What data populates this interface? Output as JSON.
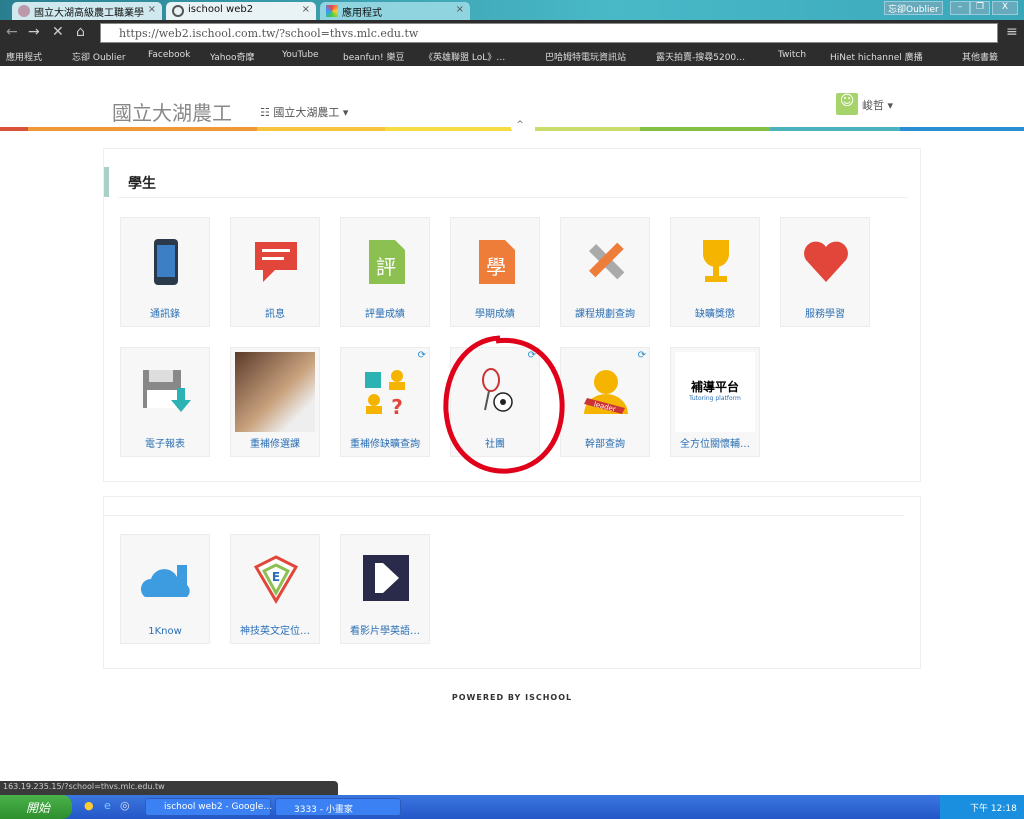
{
  "browser": {
    "tabs": [
      {
        "label": "國立大湖高級農工職業學"
      },
      {
        "label": "ischool web2"
      },
      {
        "label": "應用程式"
      }
    ],
    "user_badge": "忘卻Oublier",
    "url": "https://web2.ischool.com.tw/?school=thvs.mlc.edu.tw",
    "bookmarks": [
      "應用程式",
      "忘卻 Oublier",
      "Facebook",
      "Yahoo奇摩",
      "YouTube",
      "beanfun! 樂豆",
      "《英雄聯盟 LoL》…",
      "巴哈姆特電玩資訊站",
      "露天拍賣-搜尋5200…",
      "Twitch",
      "HiNet hichannel 廣播",
      "其他書籤"
    ],
    "status_url": "163.19.235.15/?school=thvs.mlc.edu.tw"
  },
  "header": {
    "site_title": "國立大湖農工",
    "school_menu": "國立大湖農工",
    "user_name": "峻哲"
  },
  "section1": {
    "title": "學生",
    "apps": [
      {
        "label": "通訊錄",
        "icon": "phone-icon"
      },
      {
        "label": "訊息",
        "icon": "message-icon"
      },
      {
        "label": "評量成績",
        "icon": "document-icon",
        "glyph": "評"
      },
      {
        "label": "學期成績",
        "icon": "document-icon",
        "glyph": "學"
      },
      {
        "label": "課程規劃查詢",
        "icon": "pencil-ruler-icon"
      },
      {
        "label": "缺曠獎懲",
        "icon": "trophy-icon"
      },
      {
        "label": "服務學習",
        "icon": "heart-icon"
      },
      {
        "label": "電子報表",
        "icon": "floppy-download-icon"
      },
      {
        "label": "重補修選課",
        "icon": "photo-icon"
      },
      {
        "label": "重補修缺曠查詢",
        "icon": "puzzle-people-icon",
        "sync": true
      },
      {
        "label": "社團",
        "icon": "ball-racket-icon",
        "sync": true,
        "highlighted": true
      },
      {
        "label": "幹部查詢",
        "icon": "leader-icon",
        "sync": true
      },
      {
        "label": "全方位關懷輔…",
        "icon": "tutoring-platform-icon",
        "logo_text": "補導平台 Tutoring platform"
      }
    ]
  },
  "section2": {
    "apps": [
      {
        "label": "1Know",
        "icon": "cloud-icon"
      },
      {
        "label": "神技英文定位…",
        "icon": "e-shield-icon"
      },
      {
        "label": "看影片學英語…",
        "icon": "video-play-icon"
      }
    ]
  },
  "footer": "POWERED BY ISCHOOL",
  "taskbar": {
    "start": "開始",
    "tasks": [
      "ischool web2 - Google…",
      "3333 - 小畫家"
    ],
    "clock": "下午 12:18"
  },
  "colors": {
    "link": "#2a6fb5",
    "highlight_circle": "#e0001a"
  }
}
